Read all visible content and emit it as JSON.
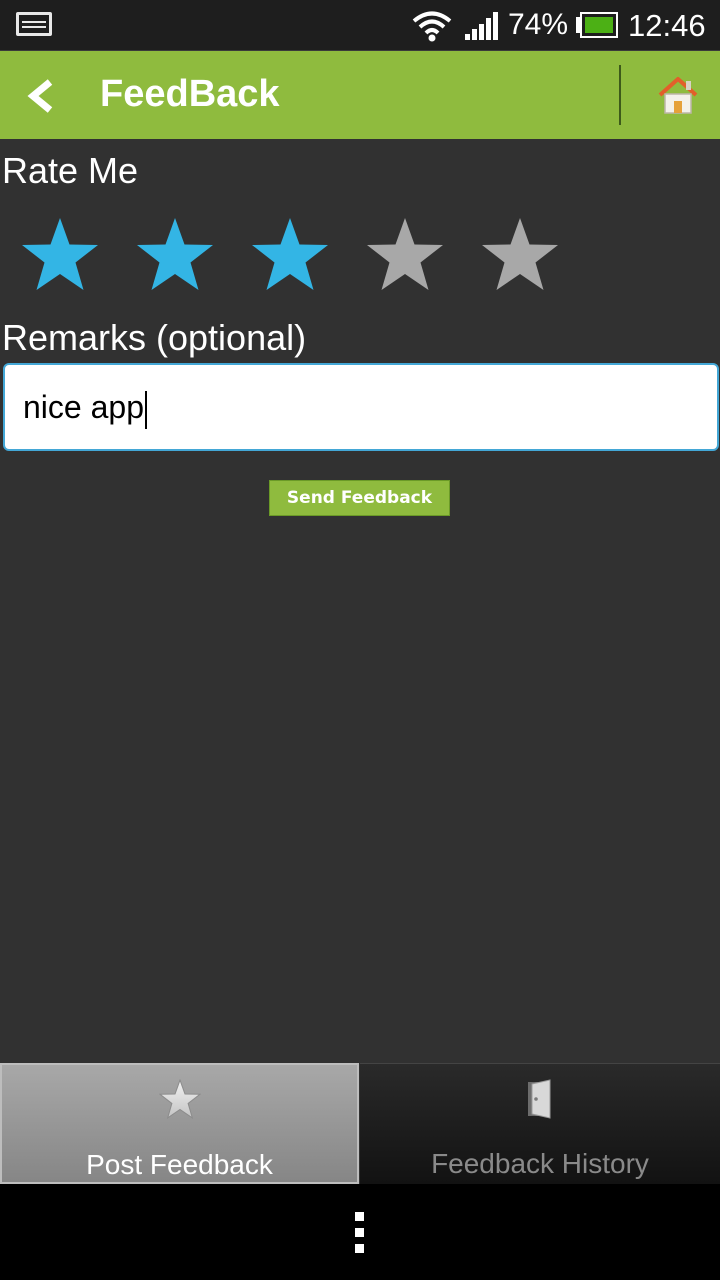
{
  "status_bar": {
    "battery_percent": "74%",
    "time": "12:46",
    "icons": [
      "image-notification-icon",
      "wifi-icon",
      "signal-icon",
      "battery-icon"
    ]
  },
  "action_bar": {
    "title": "FeedBack",
    "back_icon": "chevron-left-icon",
    "home_icon": "home-icon"
  },
  "rating": {
    "label": "Rate Me",
    "value": 3,
    "max": 5,
    "active_color": "#33b5e5",
    "inactive_color": "#a8a8a8"
  },
  "remarks": {
    "label": "Remarks (optional)",
    "value": "nice app"
  },
  "send_button": {
    "label": "Send Feedback",
    "color": "#8fbb3e"
  },
  "tabs": [
    {
      "label": "Post Feedback",
      "icon": "star-icon",
      "selected": true
    },
    {
      "label": "Feedback History",
      "icon": "door-icon",
      "selected": false
    }
  ],
  "nav_bar": {
    "icon": "overflow-menu-icon"
  }
}
